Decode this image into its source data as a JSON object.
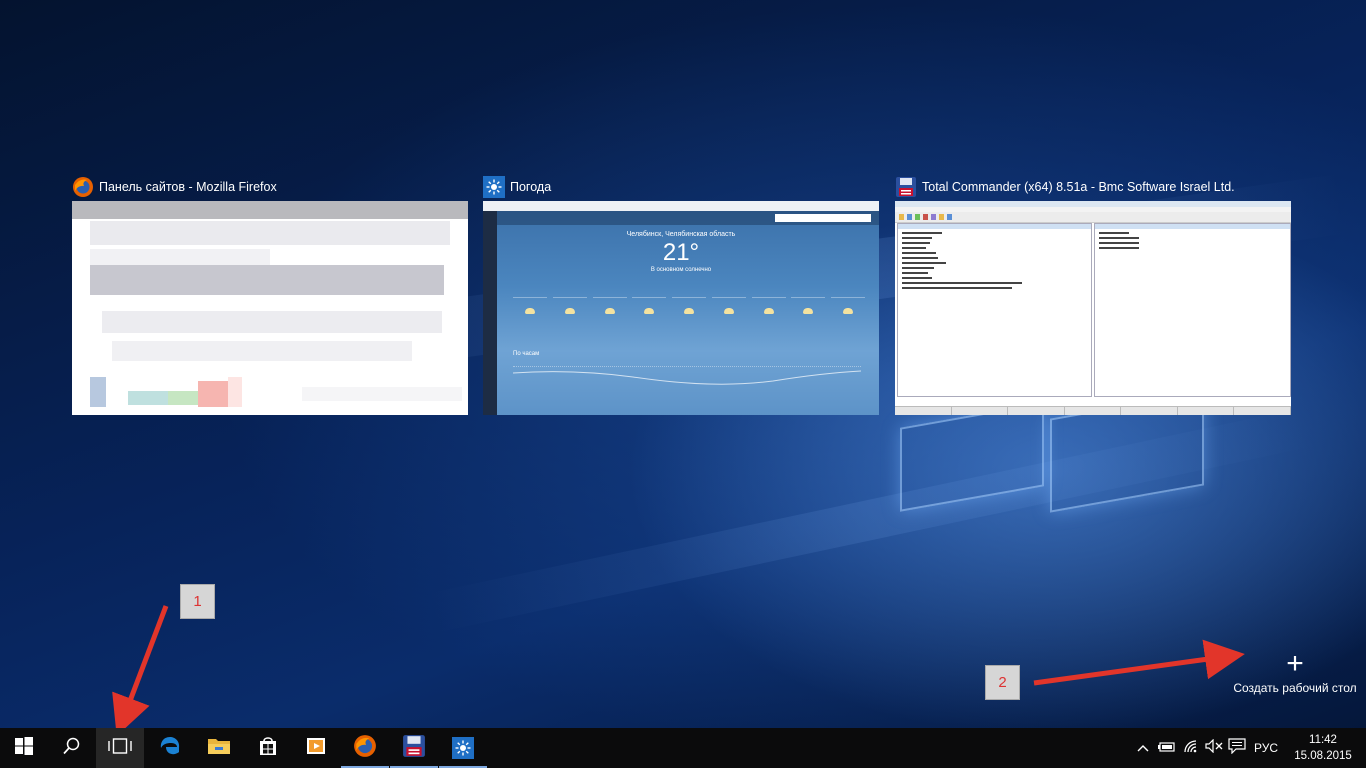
{
  "task_view": {
    "windows": [
      {
        "title": "Панель сайтов - Mozilla Firefox",
        "icon": "firefox-icon"
      },
      {
        "title": "Погода",
        "icon": "weather-icon"
      },
      {
        "title": "Total Commander (x64) 8.51a - Bmc Software Israel Ltd.",
        "icon": "floppy-icon"
      }
    ],
    "weather_preview": {
      "city": "Челябинск, Челябинская область",
      "temperature": "21°",
      "description": "В основном солнечно",
      "hourly_label": "По часам"
    },
    "new_desktop_label": "Создать рабочий стол"
  },
  "callouts": [
    {
      "number": "1",
      "color": "#d33b2c"
    },
    {
      "number": "2",
      "color": "#d33b2c"
    }
  ],
  "taskbar": {
    "buttons": [
      "start-icon",
      "search-icon",
      "task-view-icon",
      "edge-icon",
      "file-explorer-icon",
      "store-icon",
      "media-player-icon",
      "firefox-icon",
      "total-commander-icon",
      "weather-icon"
    ],
    "tray": {
      "language": "РУС",
      "time": "11:42",
      "date": "15.08.2015"
    }
  },
  "colors": {
    "accent": "#7ea8e0",
    "taskbar": "#0b0b0c",
    "callout_arrow": "#e2352a"
  }
}
